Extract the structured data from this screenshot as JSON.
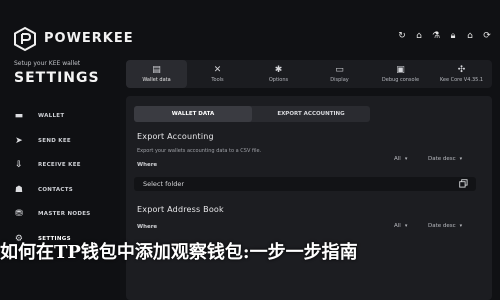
{
  "brand": {
    "name": "POWERKEE",
    "setup_text": "Setup your KEE wallet",
    "section_title": "SETTINGS"
  },
  "sidebar": {
    "items": [
      {
        "label": "WALLET",
        "icon": "wallet-icon"
      },
      {
        "label": "SEND KEE",
        "icon": "send-icon"
      },
      {
        "label": "RECEIVE KEE",
        "icon": "receive-icon"
      },
      {
        "label": "CONTACTS",
        "icon": "contacts-icon"
      },
      {
        "label": "MASTER NODES",
        "icon": "nodes-icon"
      },
      {
        "label": "SETTINGS",
        "icon": "gear-icon"
      }
    ]
  },
  "topbar": {
    "icons": [
      "refresh-icon",
      "bank-icon",
      "flask-icon",
      "lock-icon",
      "home-icon",
      "sync-icon"
    ]
  },
  "tabs": [
    {
      "label": "Wallet data",
      "icon": "database-icon"
    },
    {
      "label": "Tools",
      "icon": "tools-icon"
    },
    {
      "label": "Options",
      "icon": "options-icon"
    },
    {
      "label": "Display",
      "icon": "display-icon"
    },
    {
      "label": "Debug console",
      "icon": "console-icon"
    },
    {
      "label": "Kee Core V4.35.1",
      "icon": "core-icon"
    }
  ],
  "subtabs": [
    {
      "label": "WALLET DATA"
    },
    {
      "label": "EXPORT ACCOUNTING"
    }
  ],
  "export_accounting": {
    "title": "Export Accounting",
    "description": "Export your wallets accounting data to a CSV file.",
    "where_label": "Where",
    "filter_all": "All",
    "filter_sort": "Date desc",
    "folder_placeholder": "Select folder"
  },
  "export_address_book": {
    "title": "Export Address Book",
    "where_label": "Where",
    "filter_all": "All",
    "filter_sort": "Date desc"
  },
  "overlay_text": "如何在TP钱包中添加观察钱包:一步一步指南"
}
